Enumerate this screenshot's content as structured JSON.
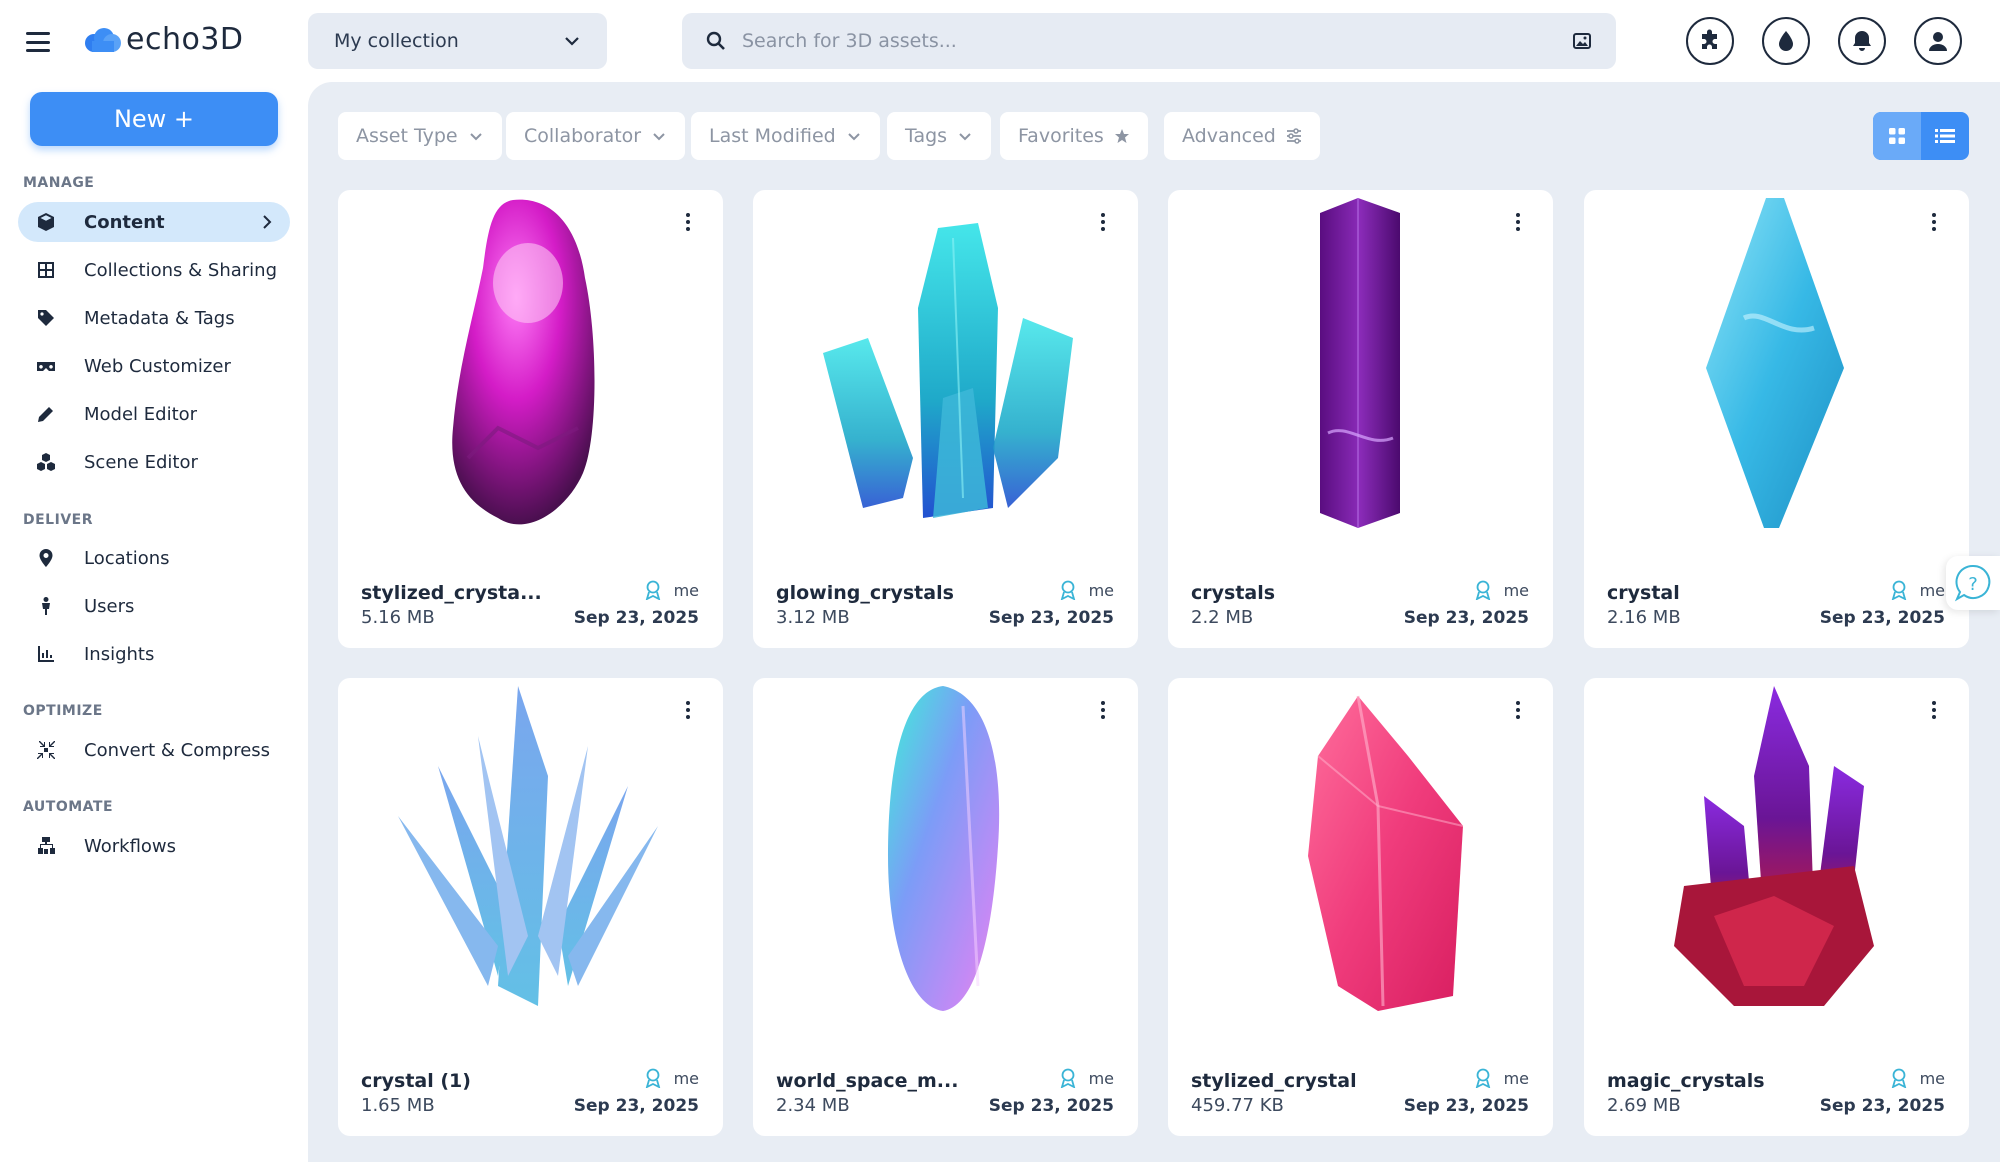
{
  "app": {
    "name": "echo3D"
  },
  "sidebar": {
    "new_button": "New +",
    "sections": {
      "manage": "MANAGE",
      "deliver": "DELIVER",
      "optimize": "OPTIMIZE",
      "automate": "AUTOMATE"
    },
    "items": [
      {
        "label": "Content",
        "icon": "cube-icon",
        "active": true
      },
      {
        "label": "Collections & Sharing",
        "icon": "grid-icon"
      },
      {
        "label": "Metadata & Tags",
        "icon": "tag-icon"
      },
      {
        "label": "Web Customizer",
        "icon": "vr-headset-icon"
      },
      {
        "label": "Model Editor",
        "icon": "pencil-icon"
      },
      {
        "label": "Scene Editor",
        "icon": "cubes-icon"
      },
      {
        "label": "Locations",
        "icon": "map-pin-icon"
      },
      {
        "label": "Users",
        "icon": "person-icon"
      },
      {
        "label": "Insights",
        "icon": "bar-chart-icon"
      },
      {
        "label": "Convert & Compress",
        "icon": "compress-icon"
      },
      {
        "label": "Workflows",
        "icon": "sitemap-icon"
      }
    ]
  },
  "topbar": {
    "collection": "My collection",
    "search_placeholder": "Search for 3D assets...",
    "icons": [
      "puzzle-icon",
      "droplet-icon",
      "bell-icon",
      "user-icon"
    ]
  },
  "filters": [
    "Asset Type",
    "Collaborator",
    "Last Modified",
    "Tags",
    "Favorites",
    "Advanced"
  ],
  "assets": [
    {
      "name": "stylized_crysta...",
      "size": "5.16 MB",
      "owner": "me",
      "date": "Sep 23, 2025"
    },
    {
      "name": "glowing_crystals",
      "size": "3.12 MB",
      "owner": "me",
      "date": "Sep 23, 2025"
    },
    {
      "name": "crystals",
      "size": "2.2 MB",
      "owner": "me",
      "date": "Sep 23, 2025"
    },
    {
      "name": "crystal",
      "size": "2.16 MB",
      "owner": "me",
      "date": "Sep 23, 2025"
    },
    {
      "name": "crystal (1)",
      "size": "1.65 MB",
      "owner": "me",
      "date": "Sep 23, 2025"
    },
    {
      "name": "world_space_m...",
      "size": "2.34 MB",
      "owner": "me",
      "date": "Sep 23, 2025"
    },
    {
      "name": "stylized_crystal",
      "size": "459.77 KB",
      "owner": "me",
      "date": "Sep 23, 2025"
    },
    {
      "name": "magic_crystals",
      "size": "2.69 MB",
      "owner": "me",
      "date": "Sep 23, 2025"
    }
  ],
  "colors": {
    "accent": "#3d8ef5",
    "active_nav": "#d3e8fb",
    "main_bg": "#e8edf4",
    "ink": "#1e2a3d"
  }
}
